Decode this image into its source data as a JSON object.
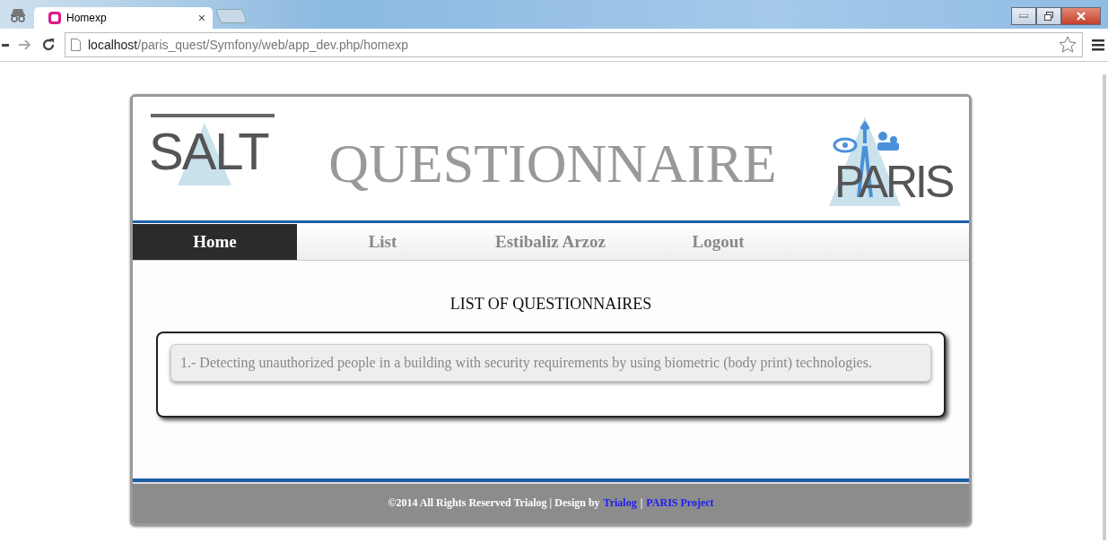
{
  "browser": {
    "tab": {
      "title": "Homexp",
      "close": "×"
    },
    "address": {
      "host": "localhost",
      "path": "/paris_quest/Symfony/web/app_dev.php/homexp"
    }
  },
  "header": {
    "left_logo": "SALT",
    "title": "QUESTIONNAIRE",
    "right_logo": "PARIS"
  },
  "nav": [
    {
      "label": "Home",
      "selected": true
    },
    {
      "label": "List",
      "selected": false
    },
    {
      "label": "Estibaliz Arzoz",
      "selected": false
    },
    {
      "label": "Logout",
      "selected": false
    }
  ],
  "content": {
    "heading": "LIST OF QUESTIONNAIRES",
    "items": [
      "1.- Detecting unauthorized people in a building with security requirements by using biometric (body print) technologies."
    ]
  },
  "footer": {
    "text": "©2014 All Rights Reserved Trialog | Design by",
    "link1": "Trialog",
    "separator": "|",
    "link2": "PARIS Project"
  }
}
